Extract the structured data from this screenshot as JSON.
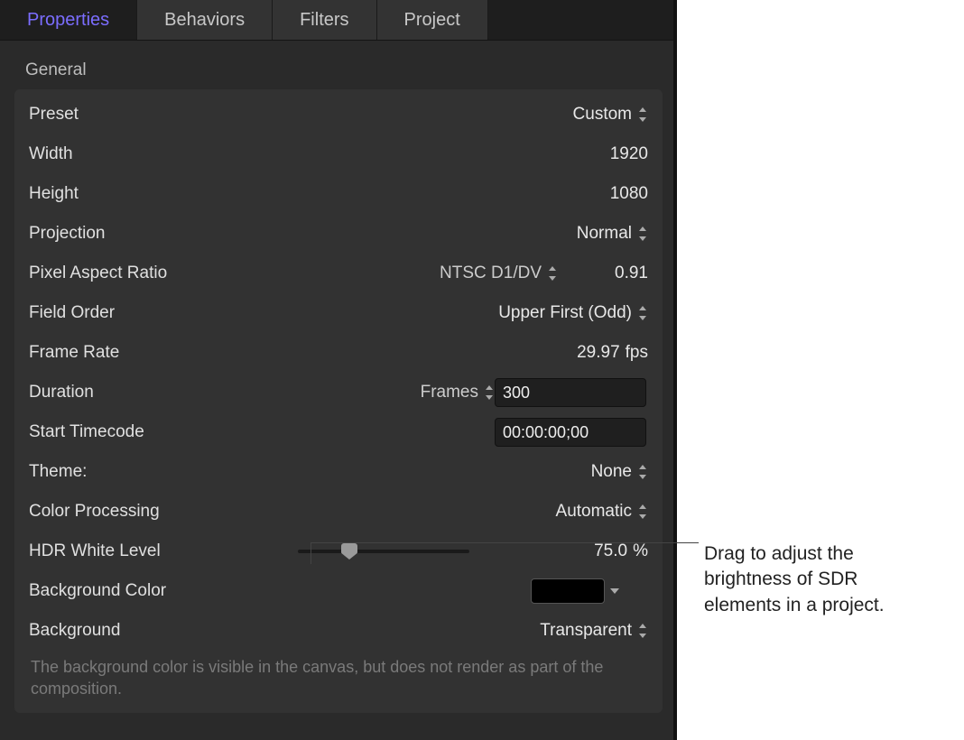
{
  "tabs": {
    "properties": "Properties",
    "behaviors": "Behaviors",
    "filters": "Filters",
    "project": "Project"
  },
  "section": {
    "general": "General"
  },
  "rows": {
    "preset": {
      "label": "Preset",
      "value": "Custom"
    },
    "width": {
      "label": "Width",
      "value": "1920"
    },
    "height": {
      "label": "Height",
      "value": "1080"
    },
    "projection": {
      "label": "Projection",
      "value": "Normal"
    },
    "par": {
      "label": "Pixel Aspect Ratio",
      "select": "NTSC D1/DV",
      "value": "0.91"
    },
    "fieldorder": {
      "label": "Field Order",
      "value": "Upper First (Odd)"
    },
    "framerate": {
      "label": "Frame Rate",
      "value": "29.97",
      "unit": "fps"
    },
    "duration": {
      "label": "Duration",
      "select": "Frames",
      "value": "300"
    },
    "starttc": {
      "label": "Start Timecode",
      "value": "00:00:00;00"
    },
    "theme": {
      "label": "Theme:",
      "value": "None"
    },
    "colorproc": {
      "label": "Color Processing",
      "value": "Automatic"
    },
    "hdr": {
      "label": "HDR White Level",
      "value": "75.0",
      "unit": "%",
      "percent": 30
    },
    "bgcolor": {
      "label": "Background Color",
      "swatch": "#000000"
    },
    "background": {
      "label": "Background",
      "value": "Transparent"
    }
  },
  "note": "The background color is visible in the canvas, but does not render as part of the composition.",
  "callout": "Drag to adjust the brightness of SDR elements in a project."
}
